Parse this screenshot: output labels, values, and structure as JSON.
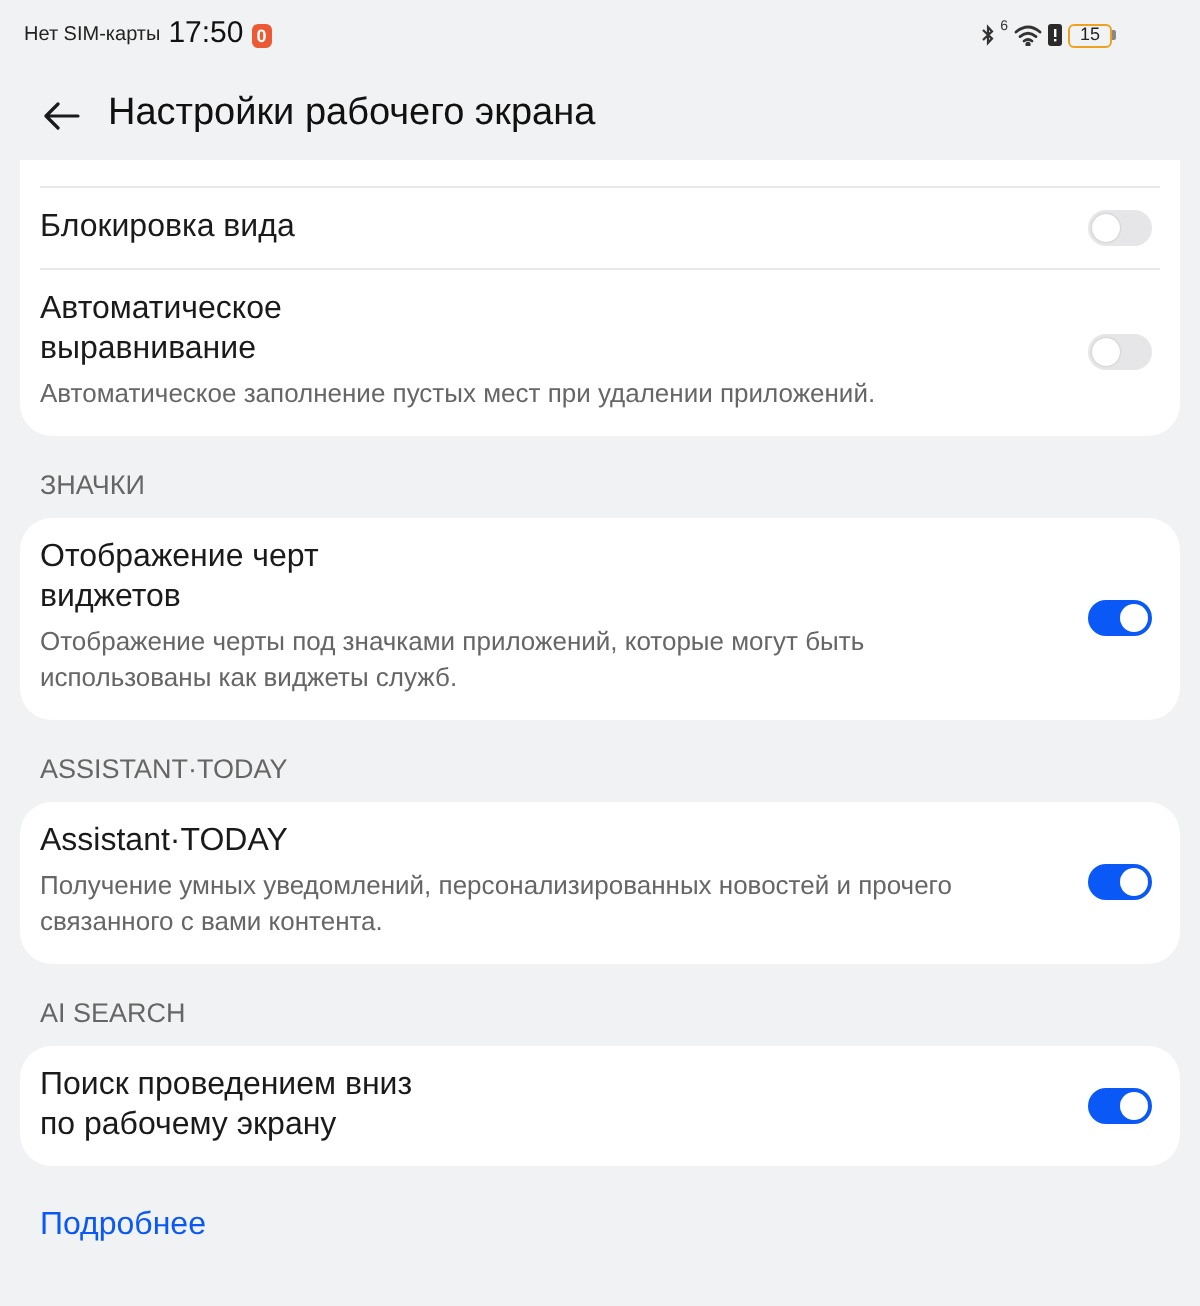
{
  "status_bar": {
    "carrier": "Нет SIM-карты",
    "time": "17:50",
    "notification_count": "0",
    "network_type": "6",
    "battery": "15"
  },
  "header": {
    "title": "Настройки рабочего экрана"
  },
  "sections": [
    {
      "items": [
        {
          "title": "Блокировка вида",
          "on": false
        },
        {
          "title": "Автоматическое\nвыравнивание",
          "description": "Автоматическое заполнение пустых мест при удалении приложений.",
          "on": false
        }
      ]
    },
    {
      "heading": "ЗНАЧКИ",
      "items": [
        {
          "title": "Отображение черт\nвиджетов",
          "description": "Отображение черты под значками приложений, которые могут быть\nиспользованы как виджеты служб.",
          "on": true
        }
      ]
    },
    {
      "heading": "ASSISTANT·TODAY",
      "items": [
        {
          "title": "Assistant·TODAY",
          "description": "Получение умных уведомлений, персонализированных новостей и прочего\nсвязанного с вами контента.",
          "on": true
        }
      ]
    },
    {
      "heading": "AI SEARCH",
      "items": [
        {
          "title": "Поиск проведением вниз\nпо рабочему экрану",
          "on": true
        }
      ]
    }
  ],
  "more_link": "Подробнее"
}
